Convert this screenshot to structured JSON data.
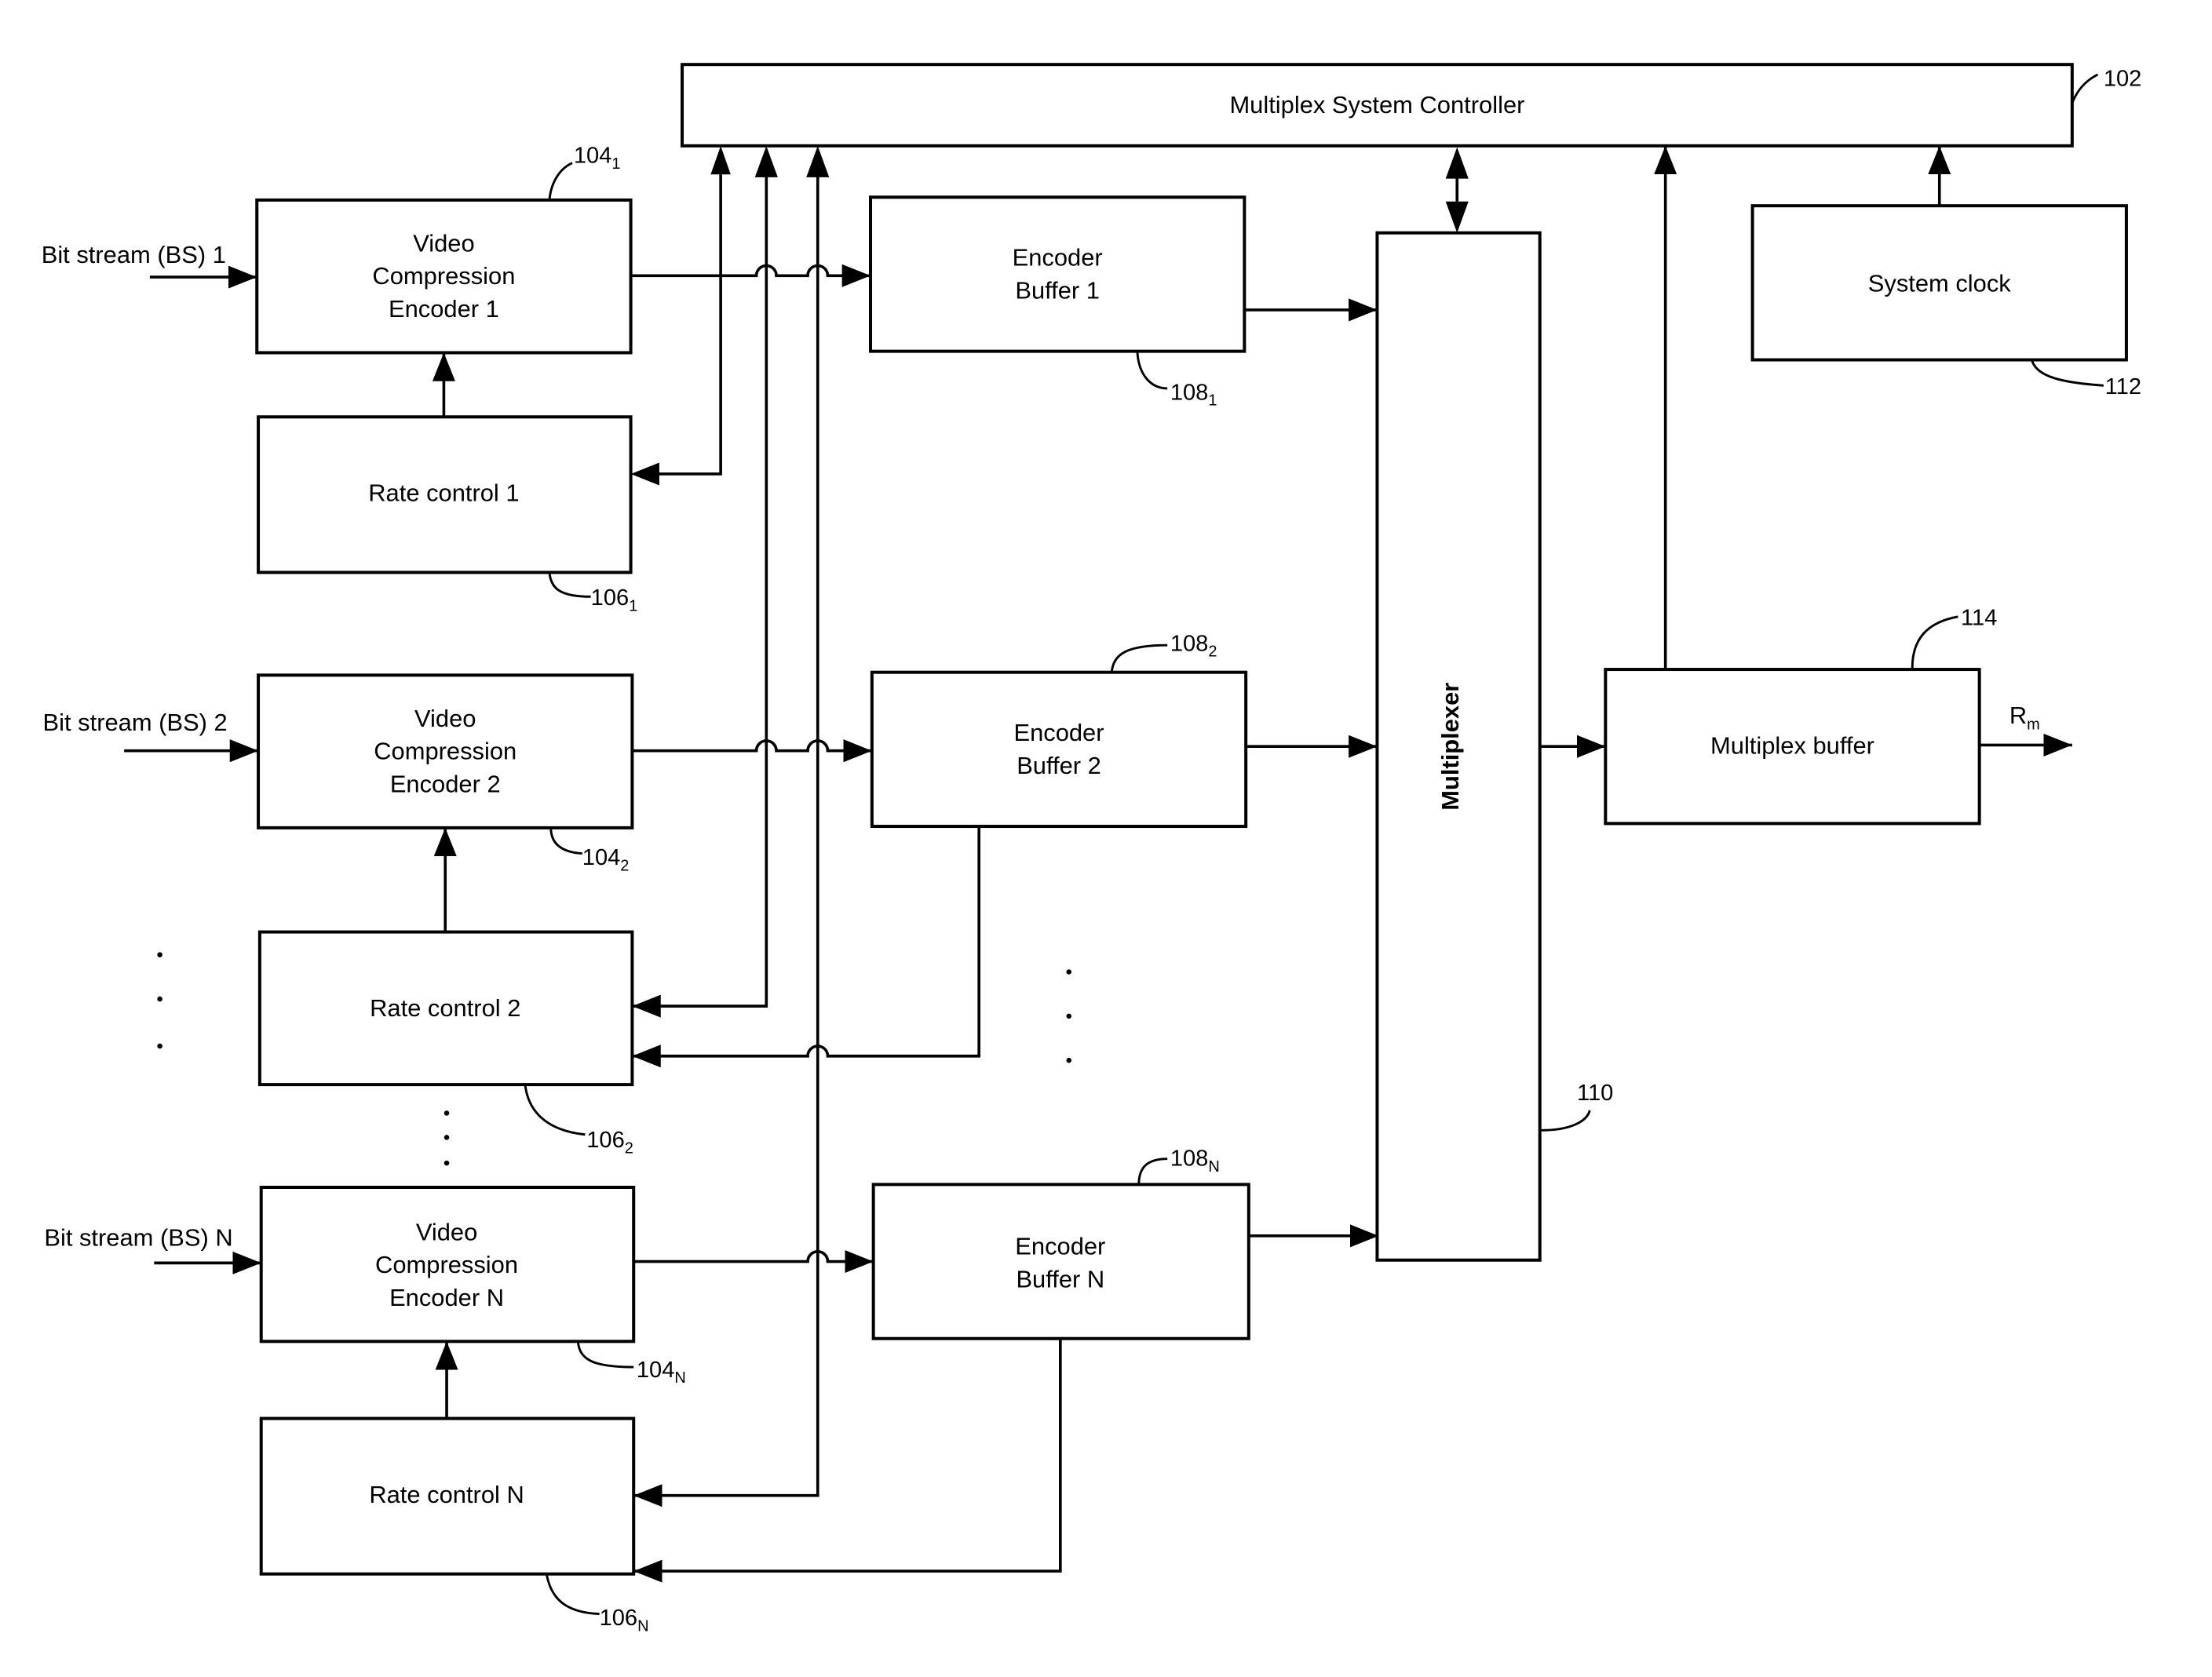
{
  "figure": {
    "controller": {
      "label": "Multiplex System Controller",
      "ref": "102"
    },
    "system_clock": {
      "label": "System clock",
      "ref": "112"
    },
    "multiplexer": {
      "label": "Multiplexer",
      "ref": "110"
    },
    "multiplex_buffer": {
      "label": "Multiplex buffer",
      "ref": "114",
      "output_label": "R",
      "output_sub": "m"
    },
    "channels": [
      {
        "input": "Bit stream (BS) 1",
        "encoder_lines": [
          "Video",
          "Compression",
          "Encoder 1"
        ],
        "encoder_ref": "104",
        "encoder_sub": "1",
        "rate_control": "Rate control 1",
        "rate_ref": "106",
        "rate_sub": "1",
        "buffer_lines": [
          "Encoder",
          "Buffer 1"
        ],
        "buffer_ref": "108",
        "buffer_sub": "1"
      },
      {
        "input": "Bit stream (BS) 2",
        "encoder_lines": [
          "Video",
          "Compression",
          "Encoder 2"
        ],
        "encoder_ref": "104",
        "encoder_sub": "2",
        "rate_control": "Rate control 2",
        "rate_ref": "106",
        "rate_sub": "2",
        "buffer_lines": [
          "Encoder",
          "Buffer 2"
        ],
        "buffer_ref": "108",
        "buffer_sub": "2"
      },
      {
        "input": "Bit stream (BS) N",
        "encoder_lines": [
          "Video",
          "Compression",
          "Encoder N"
        ],
        "encoder_ref": "104",
        "encoder_sub": "N",
        "rate_control": "Rate control N",
        "rate_ref": "106",
        "rate_sub": "N",
        "buffer_lines": [
          "Encoder",
          "Buffer N"
        ],
        "buffer_ref": "108",
        "buffer_sub": "N"
      }
    ]
  }
}
